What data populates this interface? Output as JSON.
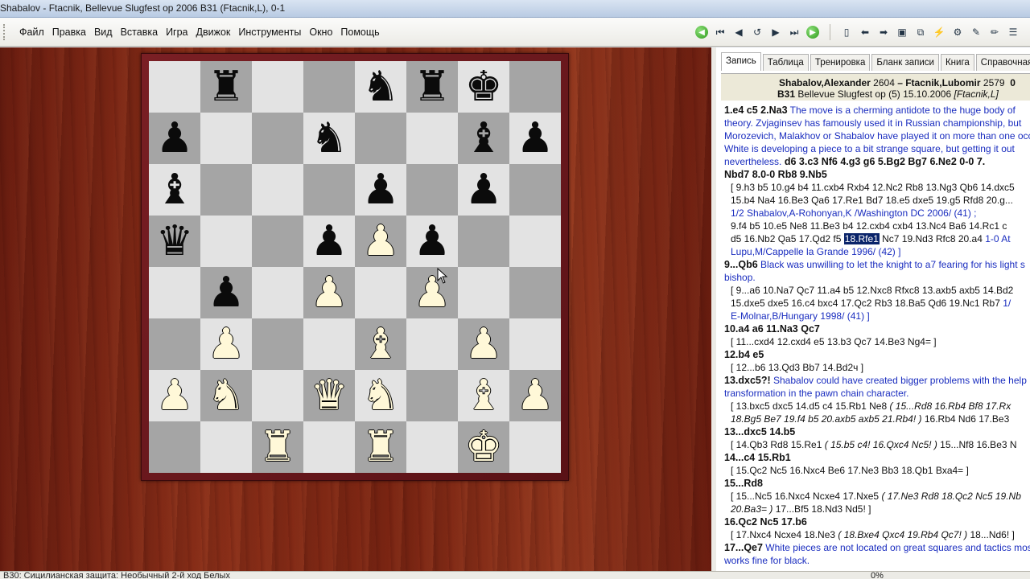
{
  "window": {
    "title": "Shabalov - Ftacnik, Bellevue Slugfest op 2006  B31  (Ftacnik,L), 0-1"
  },
  "menu": {
    "items": [
      "Файл",
      "Правка",
      "Вид",
      "Вставка",
      "Игра",
      "Движок",
      "Инструменты",
      "Окно",
      "Помощь"
    ]
  },
  "toolbar": {
    "icons": [
      "back-green-icon",
      "first-move-icon",
      "prev-move-icon",
      "undo-icon",
      "next-move-icon",
      "last-move-icon",
      "forward-green-icon",
      "new-game-icon",
      "prev-game-icon",
      "next-game-icon",
      "save-icon",
      "copy-icon",
      "analysis-icon",
      "settings-icon",
      "erase-icon",
      "pen-icon",
      "more-icon"
    ]
  },
  "board": {
    "rows": [
      [
        "",
        "bR",
        "",
        "",
        "bN",
        "bR",
        "bK",
        ""
      ],
      [
        "bP",
        "",
        "",
        "bN",
        "",
        "",
        "bB",
        "bP"
      ],
      [
        "bB",
        "",
        "",
        "",
        "bP",
        "",
        "bP",
        ""
      ],
      [
        "bQ",
        "",
        "",
        "bP",
        "wP",
        "bP",
        "",
        ""
      ],
      [
        "",
        "bP",
        "",
        "wP",
        "",
        "wP",
        "",
        ""
      ],
      [
        "",
        "wP",
        "",
        "",
        "wB",
        "",
        "wP",
        ""
      ],
      [
        "wP",
        "wN",
        "",
        "wQ",
        "wN",
        "",
        "wB",
        "wP"
      ],
      [
        "",
        "",
        "wR",
        "",
        "wR",
        "",
        "wK",
        ""
      ]
    ]
  },
  "tabs": [
    "Запись",
    "Таблица",
    "Тренировка",
    "Бланк записи",
    "Книга",
    "Справочная"
  ],
  "game": {
    "white": "Shabalov,Alexander",
    "white_elo": "2604",
    "dash": " – ",
    "black": "Ftacnik,Lubomir",
    "black_elo": "2579",
    "result": "0",
    "eco": "B31",
    "event": "Bellevue Slugfest op (5) 15.10.2006",
    "annotator": "[Ftacnik,L]"
  },
  "notation": {
    "l1_mv": "1.e4  c5  2.Na3",
    "l1_cm": " The move is a cherming antidote to the  huge body of",
    "l2": "theory. Zvjaginsev has famously used it in Russian championship, but",
    "l3": "Morozevich, Malakhov or Shabalov have played it on more than one occasion.",
    "l4": "White is developing a piece to a bit strange square, but getting it out",
    "l5_cm": "nevertheless.",
    "l5_mv": "  d6  3.c3  Nf6  4.g3  g6  5.Bg2  Bg7  6.Ne2  0-0  7.",
    "l6_mv": "Nbd7  8.0-0  Rb8  9.Nb5",
    "l7": "[ 9.h3  b5  10.g4  b4  11.cxb4  Rxb4  12.Nc2  Rb8  13.Ng3  Qb6  14.dxc5",
    "l8": "15.b4  Na4  16.Be3  Qa6  17.Re1  Bd7  18.e5  dxe5  19.g5  Rfd8  20.g...",
    "l9": "1/2 Shabalov,A-Rohonyan,K /Washington DC 2006/ (41) ;",
    "l10": "9.f4  b5  10.e5  Ne8  11.Be3  b4  12.cxb4  cxb4  13.Nc4  Ba6  14.Rc1  c",
    "l11_a": "d5  16.Nb2  Qa5  17.Qd2  f5 ",
    "l11_sel": "18.Rfe1",
    "l11_b": "  Nc7  19.Nd3  Rfc8  20.a4 ",
    "l11_c": " 1-0 At",
    "l12": "Lupu,M/Cappelle la Grande 1996/ (42) ]",
    "l13_mv": "9...Qb6",
    "l13_cm": "  Black was unwilling to let the knight to a7 fearing for his light s",
    "l14": "bishop.",
    "l15": "[ 9...a6  10.Na7  Qc7  11.a4  b5  12.Nxc8  Rfxc8  13.axb5  axb5  14.Bd2",
    "l16_a": "15.dxe5  dxe5  16.c4  bxc4  17.Qc2  Rb3  18.Ba5  Qd6  19.Nc1  Rb7 ",
    "l16_b": " 1/",
    "l17": "E-Molnar,B/Hungary 1998/ (41) ]",
    "l18_mv": "10.a4  a6  11.Na3  Qc7",
    "l19": "[ 11...cxd4  12.cxd4  e5  13.b3  Qc7  14.Be3  Ng4= ]",
    "l20_mv": "12.b4  e5",
    "l21": "[ 12...b6  13.Qd3  Bb7  14.Bd2ч ]",
    "l22_mv": "13.dxc5?!",
    "l22_cm": "  Shabalov could have created bigger problems with the help",
    "l23": "transformation in the pawn chain character.",
    "l24_a": "[ 13.bxc5  dxc5  14.d5  c4  15.Rb1  Ne8  ",
    "l24_b": "( 15...Rd8  16.Rb4  Bf8  17.Rx",
    "l25_a": "18.Bg5  Be7  19.f4  b5  20.axb5  axb5  21.Rb4! )",
    "l25_b": "  16.Rb4  Nd6  17.Be3",
    "l26_mv": "13...dxc5  14.b5",
    "l27_a": "[ 14.Qb3  Rd8  15.Re1  ",
    "l27_b": "( 15.b5  c4!  16.Qxc4  Nc5! )",
    "l27_c": "  15...Nf8  16.Be3  N",
    "l28_mv": "14...c4  15.Rb1",
    "l29": "[ 15.Qc2  Nc5  16.Nxc4  Be6  17.Ne3  Bb3  18.Qb1  Bxa4= ]",
    "l30_mv": "15...Rd8",
    "l31_a": "[ 15...Nc5  16.Nxc4  Ncxe4  17.Nxe5  ",
    "l31_b": "( 17.Ne3  Rd8  18.Qc2  Nc5  19.Nb",
    "l32_a": "20.Ba3= )",
    "l32_b": "  17...Bf5  18.Nd3  Nd5! ]",
    "l33_mv": "16.Qc2  Nc5  17.b6",
    "l34_a": "[ 17.Nxc4  Ncxe4  18.Ne3  ",
    "l34_b": "( 18.Bxe4  Qxc4  19.Rb4  Qc7! )",
    "l34_c": "  18...Nd6! ]",
    "l35_mv": "17...Qe7",
    "l35_cm": "  White pieces are not located on great squares and tactics mostly",
    "l36": "works fine for black."
  },
  "status": {
    "text": "B30: Сицилианская защита: Необычный 2-й ход Белых",
    "percent": "0%"
  }
}
